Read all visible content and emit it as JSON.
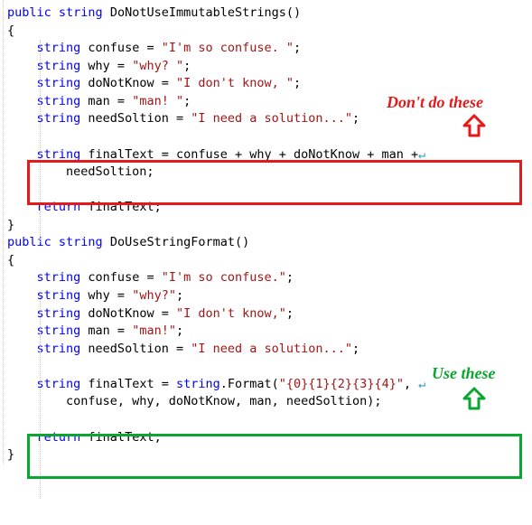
{
  "code": {
    "method1": {
      "sig_public": "public",
      "sig_string": "string",
      "sig_name": " DoNotUseImmutableStrings()",
      "brace_open": "{",
      "l1_kw": "string",
      "l1_rest": " confuse = ",
      "l1_str": "\"I'm so confuse. \"",
      "l1_end": ";",
      "l2_kw": "string",
      "l2_rest": " why = ",
      "l2_str": "\"why? \"",
      "l2_end": ";",
      "l3_kw": "string",
      "l3_rest": " doNotKnow = ",
      "l3_str": "\"I don't know, \"",
      "l3_end": ";",
      "l4_kw": "string",
      "l4_rest": " man = ",
      "l4_str": "\"man! \"",
      "l4_end": ";",
      "l5_kw": "string",
      "l5_rest": " needSoltion = ",
      "l5_str": "\"I need a solution...\"",
      "l5_end": ";",
      "l6_kw": "string",
      "l6_rest": " finalText = confuse + why + doNotKnow + man +",
      "l6_wrap": "↵",
      "l7_rest": "        needSoltion;",
      "l8_kw": "return",
      "l8_rest": " finalText;",
      "brace_close": "}"
    },
    "method2": {
      "sig_public": "public",
      "sig_string": "string",
      "sig_name": " DoUseStringFormat()",
      "brace_open": "{",
      "l1_kw": "string",
      "l1_rest": " confuse = ",
      "l1_str": "\"I'm so confuse.\"",
      "l1_end": ";",
      "l2_kw": "string",
      "l2_rest": " why = ",
      "l2_str": "\"why?\"",
      "l2_end": ";",
      "l3_kw": "string",
      "l3_rest": " doNotKnow = ",
      "l3_str": "\"I don't know,\"",
      "l3_end": ";",
      "l4_kw": "string",
      "l4_rest": " man = ",
      "l4_str": "\"man!\"",
      "l4_end": ";",
      "l5_kw": "string",
      "l5_rest": " needSoltion = ",
      "l5_str": "\"I need a solution...\"",
      "l5_end": ";",
      "l6_kw": "string",
      "l6_rest": " finalText = ",
      "l6_kw2": "string",
      "l6_mid": ".Format(",
      "l6_str": "\"{0}{1}{2}{3}{4}\"",
      "l6_end": ", ",
      "l6_wrap": "↵",
      "l7_rest": "        confuse, why, doNotKnow, man, needSoltion);",
      "l8_kw": "return",
      "l8_rest": " finalText;",
      "brace_close": "}"
    }
  },
  "annotations": {
    "dont": "Don't do these",
    "use": "Use these"
  }
}
